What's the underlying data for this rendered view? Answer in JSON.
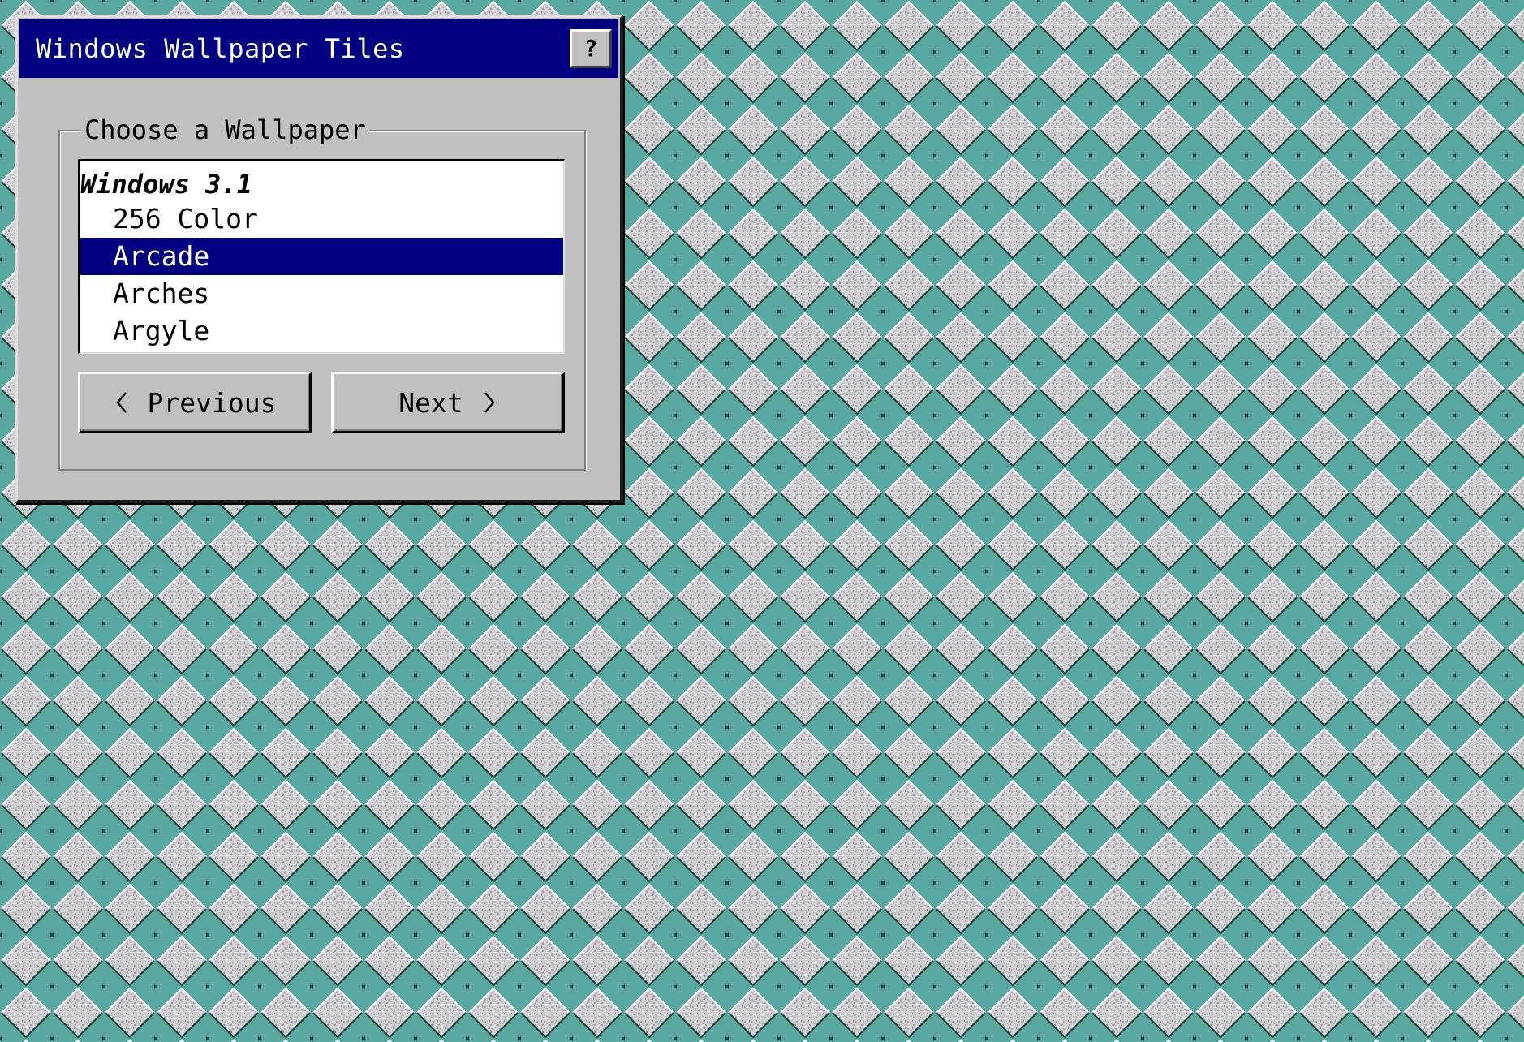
{
  "window": {
    "title": "Windows Wallpaper Tiles",
    "help_label": "?"
  },
  "chooser": {
    "group_label": "Choose a Wallpaper",
    "list_group_header": "Windows 3.1",
    "items": [
      {
        "label": "256 Color",
        "selected": false
      },
      {
        "label": "Arcade",
        "selected": true
      },
      {
        "label": "Arches",
        "selected": false
      },
      {
        "label": "Argyle",
        "selected": false
      }
    ]
  },
  "buttons": {
    "previous_label": "Previous",
    "next_label": "Next",
    "previous_icon": "chevron-left-icon",
    "next_icon": "chevron-right-icon"
  },
  "colors": {
    "desktop_teal": "#58a8a0",
    "tile_gray": "#c8c8cc",
    "titlebar": "#000080",
    "selection": "#000080",
    "dialog_face": "#c0c0c0"
  }
}
